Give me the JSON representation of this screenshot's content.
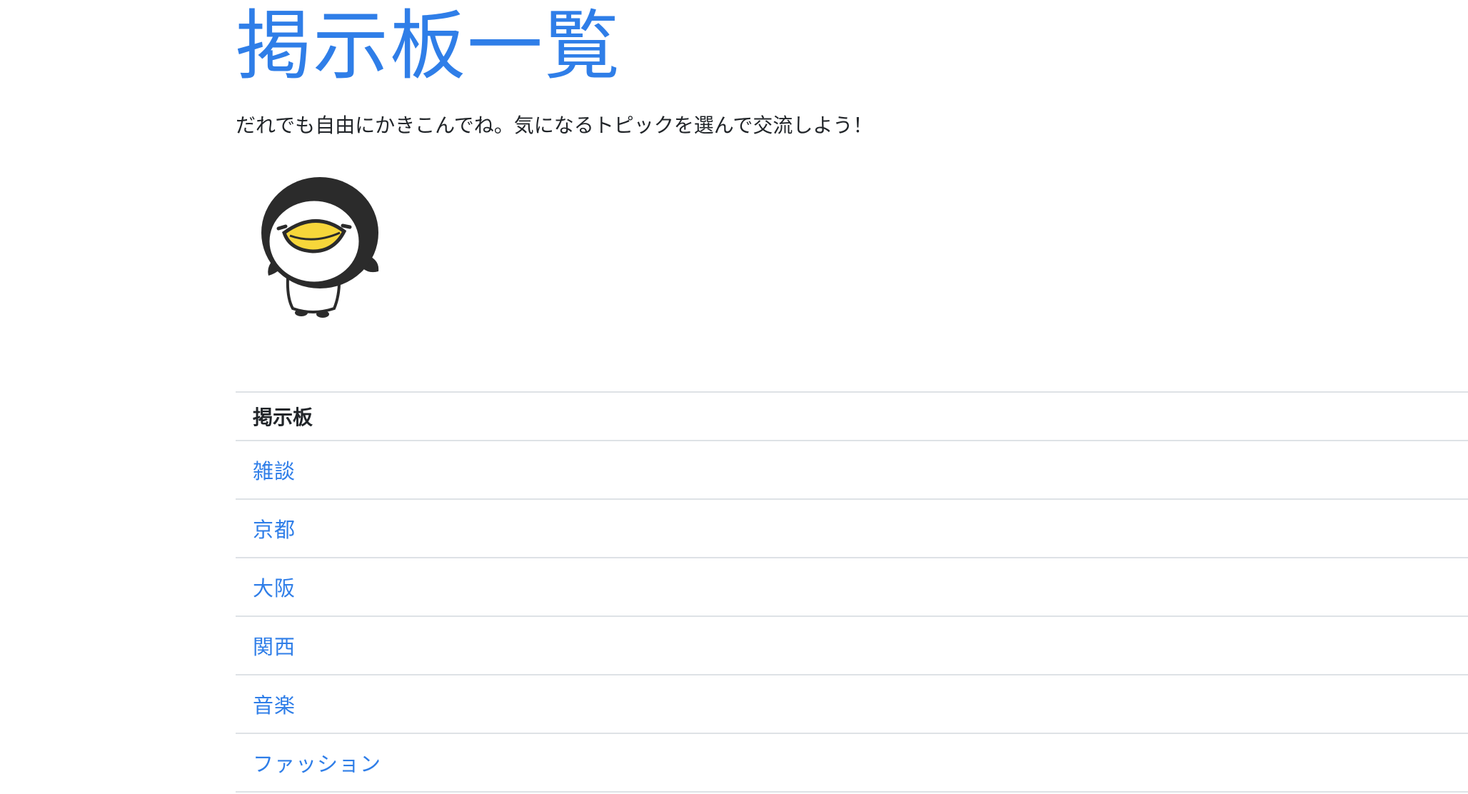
{
  "header": {
    "title": "掲示板一覧",
    "subtitle": "だれでも自由にかきこんでね。気になるトピックを選んで交流しよう！"
  },
  "mascot": {
    "icon": "penguin-icon",
    "colors": {
      "beak": "#f7d63a",
      "body": "#2b2b2b",
      "face": "#ffffff"
    }
  },
  "board_table": {
    "header": "掲示板",
    "rows": [
      {
        "label": "雑談"
      },
      {
        "label": "京都"
      },
      {
        "label": "大阪"
      },
      {
        "label": "関西"
      },
      {
        "label": "音楽"
      },
      {
        "label": "ファッション"
      }
    ]
  },
  "colors": {
    "accent": "#2f7ee8",
    "text": "#212529",
    "border": "#dee2e6"
  }
}
